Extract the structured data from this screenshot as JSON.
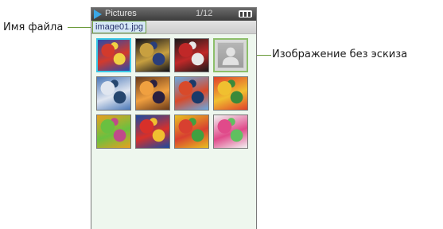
{
  "labels": {
    "file_name_callout": "Имя файла",
    "no_thumbnail_callout": "Изображение без эскиза"
  },
  "window": {
    "icon": "play-icon",
    "title": "Pictures",
    "counter": "1/12",
    "battery_icon": "battery-icon"
  },
  "file": {
    "name": "image01.jpg"
  },
  "colors": {
    "selection": "#39c7e6",
    "callout_line": "#6a9a3a",
    "panel_bg": "#eef7ee"
  },
  "grid": {
    "rows": 3,
    "columns": 4,
    "thumbnails": [
      {
        "name": "thumbnail-1",
        "subject": "balloons",
        "selected": true,
        "colors": [
          "#2b4aa8",
          "#d33a2c",
          "#f0d244"
        ]
      },
      {
        "name": "thumbnail-2",
        "subject": "city-night",
        "colors": [
          "#101018",
          "#c8a040",
          "#2a3e7a"
        ]
      },
      {
        "name": "thumbnail-3",
        "subject": "bedroom",
        "colors": [
          "#1a1a1a",
          "#c02828",
          "#e8e8e8"
        ]
      },
      {
        "name": "thumbnail-4",
        "subject": "no-thumbnail",
        "placeholder": true
      },
      {
        "name": "thumbnail-5",
        "subject": "sky-water",
        "colors": [
          "#4a78b8",
          "#e0e6f0",
          "#26466e"
        ]
      },
      {
        "name": "thumbnail-6",
        "subject": "sunset",
        "colors": [
          "#6a3a18",
          "#f0a040",
          "#2a2040"
        ]
      },
      {
        "name": "thumbnail-7",
        "subject": "hot-air-balloon",
        "colors": [
          "#6aa8e0",
          "#d84a2a",
          "#1a3a6a"
        ]
      },
      {
        "name": "thumbnail-8",
        "subject": "toy-blocks",
        "colors": [
          "#e0402a",
          "#f0c030",
          "#3a8a3a"
        ]
      },
      {
        "name": "thumbnail-9",
        "subject": "lollipop",
        "colors": [
          "#e8a020",
          "#6ac040",
          "#c04a8a"
        ]
      },
      {
        "name": "thumbnail-10",
        "subject": "balloons-blue",
        "colors": [
          "#1a4aa0",
          "#d8302a",
          "#f0c030"
        ]
      },
      {
        "name": "thumbnail-11",
        "subject": "gummy-bears",
        "colors": [
          "#e8c020",
          "#d84030",
          "#40a040"
        ]
      },
      {
        "name": "thumbnail-12",
        "subject": "candies",
        "colors": [
          "#f2f2f2",
          "#e04a8a",
          "#60c060"
        ]
      }
    ]
  }
}
